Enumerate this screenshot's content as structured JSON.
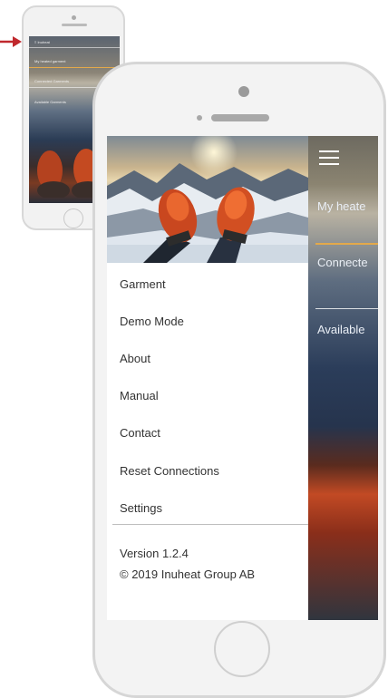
{
  "thumbnail": {
    "header_text": "≡ Inuheat",
    "items": [
      "My heated garment",
      "Connected Garments",
      "Available Garments"
    ]
  },
  "menu": {
    "items": [
      {
        "label": "Garment"
      },
      {
        "label": "Demo Mode"
      },
      {
        "label": "About"
      },
      {
        "label": "Manual"
      },
      {
        "label": "Contact"
      },
      {
        "label": "Reset Connections"
      },
      {
        "label": "Settings"
      }
    ]
  },
  "footer": {
    "version": "Version 1.2.4",
    "copyright": "© 2019 Inuheat Group AB"
  },
  "main_view": {
    "items": [
      "My heate",
      "Connecte",
      "Available"
    ]
  },
  "colors": {
    "arrow": "#c0282d",
    "accent_line": "#e3a94b",
    "menu_text": "#333333"
  }
}
